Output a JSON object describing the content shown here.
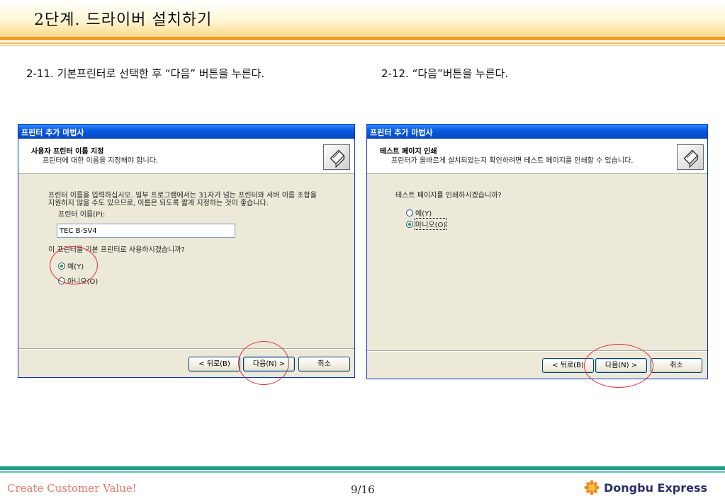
{
  "header": {
    "title": "2단계. 드라이버 설치하기"
  },
  "captions": {
    "left": "2-11. 기본프린터로 선택한 후 “다음” 버튼을 누른다.",
    "right": "2-12. “다음”버튼을 누른다."
  },
  "dialog_left": {
    "window_title": "프린터 추가 마법사",
    "header_title": "사용자 프린터 이름 지정",
    "header_subtitle": "프린터에 대한 이름을 지정해야 합니다.",
    "instruction_line1": "프린터 이름을 입력하십시오. 일부 프로그램에서는 31자가 넘는 프린터와 서버 이름 조합을",
    "instruction_line2": "지원하지 않을 수도 있으므로, 이름은 되도록 짧게 지정하는 것이 좋습니다.",
    "name_label": "프린터 이름(P):",
    "name_value": "TEC B-SV4",
    "question": "이 프린터를 기본 프린터로 사용하시겠습니까?",
    "options": [
      {
        "label": "예(Y)",
        "selected": true
      },
      {
        "label": "아니오(O)",
        "selected": false
      }
    ],
    "buttons": {
      "back": "< 뒤로(B)",
      "next": "다음(N) >",
      "cancel": "취소"
    }
  },
  "dialog_right": {
    "window_title": "프린터 추가 마법사",
    "header_title": "테스트 페이지 인쇄",
    "header_subtitle": "프린터가 올바르게 설치되었는지 확인하려면 테스트 페이지를 인쇄할 수 있습니다.",
    "question": "테스트 페이지를 인쇄하시겠습니까?",
    "options": [
      {
        "label": "예(Y)",
        "selected": false
      },
      {
        "label": "아니오(O)",
        "selected": true
      }
    ],
    "buttons": {
      "back": "< 뒤로(B)",
      "next": "다음(N) >",
      "cancel": "취소"
    }
  },
  "footer": {
    "slogan": "Create Customer Value!",
    "page": "9/16",
    "logo": "Dongbu Express"
  },
  "colors": {
    "header_accent": "#f29a1f",
    "footer_accent": "#1f9e8a",
    "highlight_circle": "#e0303a",
    "xp_titlebar": "#0a5fe8"
  }
}
